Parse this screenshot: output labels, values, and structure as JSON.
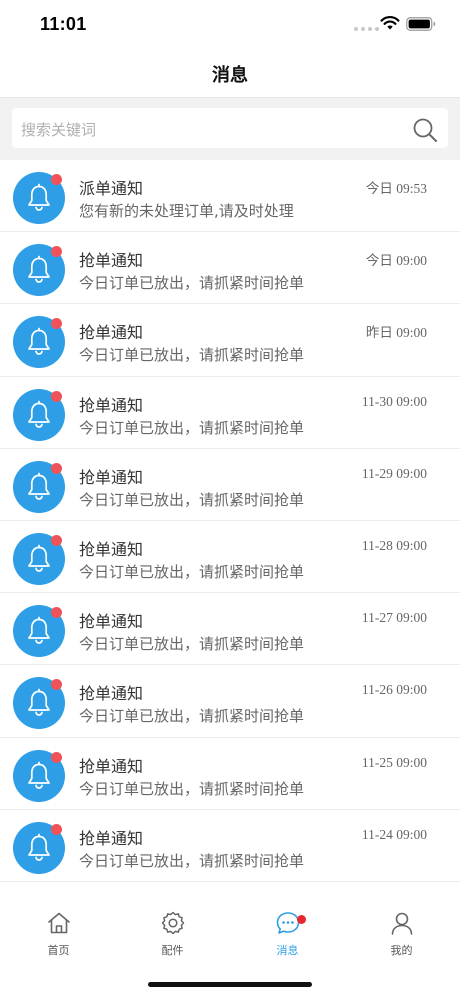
{
  "status_bar": {
    "time": "11:01"
  },
  "nav": {
    "title": "消息"
  },
  "search": {
    "placeholder": "搜索关键词"
  },
  "messages": [
    {
      "title": "派单通知",
      "subtitle": "您有新的未处理订单,请及时处理",
      "time": "今日 09:53",
      "unread": true
    },
    {
      "title": "抢单通知",
      "subtitle": "今日订单已放出，请抓紧时间抢单",
      "time": "今日 09:00",
      "unread": true
    },
    {
      "title": "抢单通知",
      "subtitle": "今日订单已放出，请抓紧时间抢单",
      "time": "昨日 09:00",
      "unread": true
    },
    {
      "title": "抢单通知",
      "subtitle": "今日订单已放出，请抓紧时间抢单",
      "time": "11-30 09:00",
      "unread": true
    },
    {
      "title": "抢单通知",
      "subtitle": "今日订单已放出，请抓紧时间抢单",
      "time": "11-29 09:00",
      "unread": true
    },
    {
      "title": "抢单通知",
      "subtitle": "今日订单已放出，请抓紧时间抢单",
      "time": "11-28 09:00",
      "unread": true
    },
    {
      "title": "抢单通知",
      "subtitle": "今日订单已放出，请抓紧时间抢单",
      "time": "11-27 09:00",
      "unread": true
    },
    {
      "title": "抢单通知",
      "subtitle": "今日订单已放出，请抓紧时间抢单",
      "time": "11-26 09:00",
      "unread": true
    },
    {
      "title": "抢单通知",
      "subtitle": "今日订单已放出，请抓紧时间抢单",
      "time": "11-25 09:00",
      "unread": true
    },
    {
      "title": "抢单通知",
      "subtitle": "今日订单已放出，请抓紧时间抢单",
      "time": "11-24 09:00",
      "unread": true
    }
  ],
  "tabbar": {
    "home_label": "首页",
    "parts_label": "配件",
    "messages_label": "消息",
    "profile_label": "我的",
    "active_tab": "消息"
  },
  "colors": {
    "accent": "#2e9fe6",
    "badge": "#f0525a",
    "tab_badge": "#e8262e"
  },
  "icons": [
    "search-icon",
    "bell-icon",
    "home-icon",
    "gear-icon",
    "chat-bubble-icon",
    "user-icon",
    "wifi-icon",
    "battery-icon"
  ]
}
